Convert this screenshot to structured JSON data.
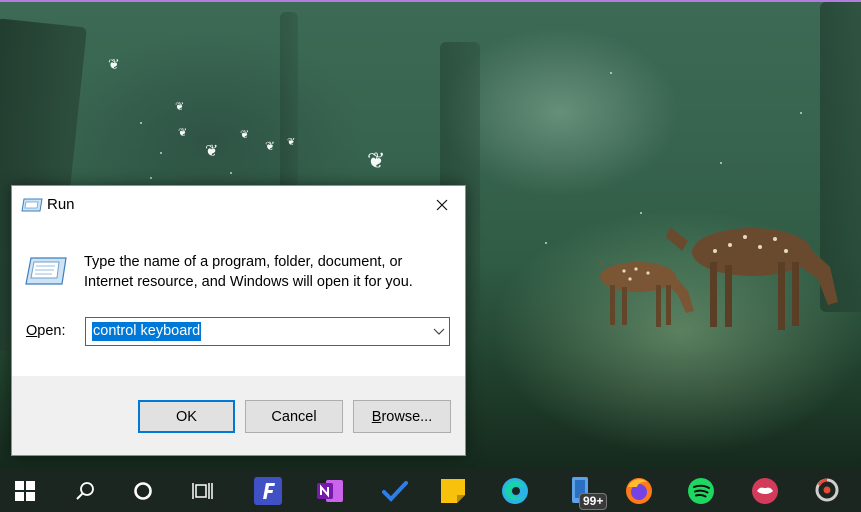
{
  "run_dialog": {
    "title": "Run",
    "description": "Type the name of a program, folder, document, or Internet resource, and Windows will open it for you.",
    "open_label_first": "O",
    "open_label_rest": "pen:",
    "input_value": "control keyboard",
    "buttons": {
      "ok": "OK",
      "cancel": "Cancel",
      "browse_first": "B",
      "browse_rest": "rowse..."
    }
  },
  "taskbar": {
    "items": [
      {
        "name": "start-button",
        "icon": "windows-logo-icon"
      },
      {
        "name": "search-button",
        "icon": "search-icon"
      },
      {
        "name": "cortana-button",
        "icon": "cortana-circle-icon"
      },
      {
        "name": "task-view-button",
        "icon": "task-view-icon"
      },
      {
        "name": "fastkeys-app",
        "icon": "f-app-icon"
      },
      {
        "name": "onenote-app",
        "icon": "onenote-icon"
      },
      {
        "name": "todo-app",
        "icon": "checkmark-icon"
      },
      {
        "name": "sticky-notes-app",
        "icon": "sticky-notes-icon"
      },
      {
        "name": "edge-app",
        "icon": "edge-icon"
      },
      {
        "name": "phone-app",
        "icon": "phone-icon"
      },
      {
        "name": "firefox-app",
        "icon": "firefox-icon"
      },
      {
        "name": "spotify-app",
        "icon": "spotify-icon"
      },
      {
        "name": "red-app",
        "icon": "lips-icon"
      },
      {
        "name": "photoscape-app",
        "icon": "photoscape-icon"
      }
    ],
    "phone_badge": "99+"
  },
  "colors": {
    "accent": "#0078d7",
    "taskbar": "#1c2620",
    "dialog_bg": "#f0f0f0"
  }
}
